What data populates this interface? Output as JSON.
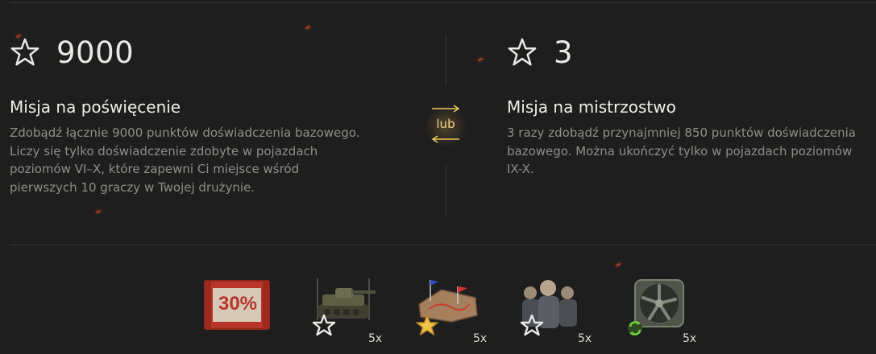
{
  "left_mission": {
    "points": "9000",
    "title": "Misja na poświęcenie",
    "description": "Zdobądź łącznie 9000 punktów doświadczenia bazowego.\nLiczy się tylko doświadczenie zdobyte w pojazdach\npoziomów VI–X, które zapewni Ci miejsce wśród\npierwszych 10 graczy w Twojej drużynie."
  },
  "right_mission": {
    "points": "3",
    "title": "Misja na mistrzostwo",
    "description": "3 razy zdobądź przynajmniej 850 punktów doświadczenia\nbazowego. Można ukończyć tylko w pojazdach poziomów\nIX-X."
  },
  "or_label": "lub",
  "rewards": [
    {
      "icon": "discount-voucher-icon",
      "label": "30%",
      "count": ""
    },
    {
      "icon": "tank-icon",
      "count": "5x"
    },
    {
      "icon": "battle-map-icon",
      "count": "5x"
    },
    {
      "icon": "crew-icon",
      "count": "5x"
    },
    {
      "icon": "cooling-fan-icon",
      "count": "5x"
    }
  ],
  "colors": {
    "background": "#1e1e1f",
    "title": "#efefec",
    "description": "#8d8d8a",
    "accent_gold": "#f0d28a",
    "voucher_red": "#b8352a"
  }
}
